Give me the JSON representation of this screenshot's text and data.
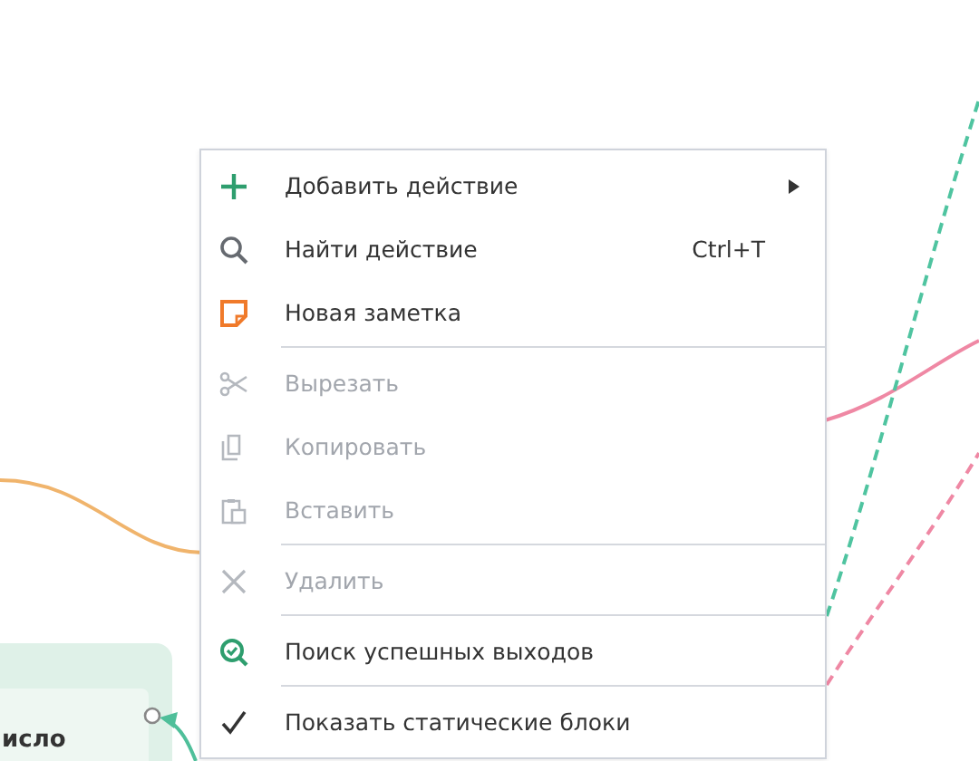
{
  "canvas": {
    "node": {
      "label": "исло"
    }
  },
  "menu": {
    "items": [
      {
        "kind": "item",
        "label": "Добавить действие",
        "has_submenu": true,
        "disabled": false,
        "checked": false
      },
      {
        "kind": "item",
        "label": "Найти действие",
        "shortcut": "Ctrl+T",
        "disabled": false,
        "checked": false
      },
      {
        "kind": "item",
        "label": "Новая заметка",
        "disabled": false,
        "checked": false
      },
      {
        "kind": "separator"
      },
      {
        "kind": "item",
        "label": "Вырезать",
        "disabled": true,
        "checked": false
      },
      {
        "kind": "item",
        "label": "Копировать",
        "disabled": true,
        "checked": false
      },
      {
        "kind": "item",
        "label": "Вставить",
        "disabled": true,
        "checked": false
      },
      {
        "kind": "separator"
      },
      {
        "kind": "item",
        "label": "Удалить",
        "disabled": true,
        "checked": false
      },
      {
        "kind": "separator"
      },
      {
        "kind": "item",
        "label": "Поиск успешных выходов",
        "disabled": false,
        "checked": false
      },
      {
        "kind": "separator"
      },
      {
        "kind": "item",
        "label": "Показать статические блоки",
        "disabled": false,
        "checked": true
      }
    ]
  }
}
